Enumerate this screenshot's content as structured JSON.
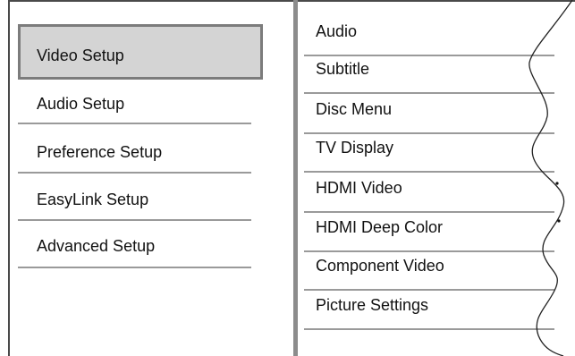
{
  "left_menu": {
    "items": [
      {
        "label": "Video Setup"
      },
      {
        "label": "Audio Setup"
      },
      {
        "label": "Preference Setup"
      },
      {
        "label": "EasyLink Setup"
      },
      {
        "label": "Advanced Setup"
      }
    ]
  },
  "right_menu": {
    "items": [
      {
        "label": "Audio"
      },
      {
        "label": "Subtitle"
      },
      {
        "label": "Disc Menu"
      },
      {
        "label": "TV Display"
      },
      {
        "label": "HDMI Video"
      },
      {
        "label": "HDMI Deep Color"
      },
      {
        "label": "Component Video"
      },
      {
        "label": "Picture Settings"
      }
    ]
  },
  "colors": {
    "selected_bg": "#d4d4d4",
    "selected_border": "#7c7c7c",
    "divider": "#8c8c8c",
    "rule": "#9a9a9a"
  }
}
